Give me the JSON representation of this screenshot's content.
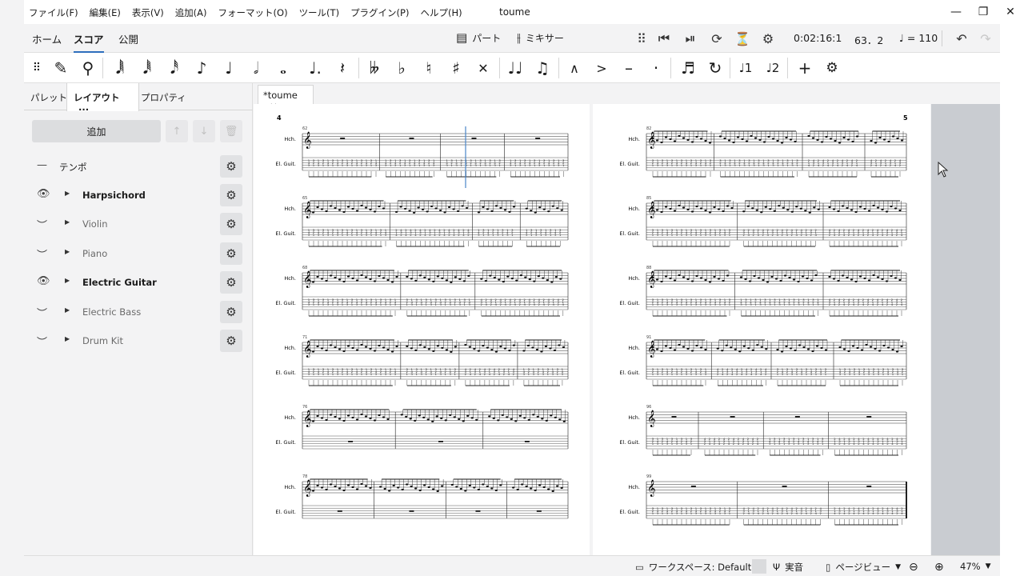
{
  "window": {
    "title": "toume",
    "menu": [
      "ファイル(F)",
      "編集(E)",
      "表示(V)",
      "追加(A)",
      "フォーマット(O)",
      "ツール(T)",
      "プラグイン(P)",
      "ヘルプ(H)"
    ]
  },
  "nav": {
    "tabs": [
      "ホーム",
      "スコア",
      "公開"
    ],
    "parts_label": "パート",
    "mixer_label": "ミキサー",
    "playback_time": "0:02:16:1",
    "measure_beat": "63．2",
    "tempo_value": "= 110"
  },
  "panel": {
    "tabs": [
      "パレット",
      "レイアウト",
      "プロパティ"
    ],
    "tab_more": "···",
    "add_label": "追加",
    "items": [
      {
        "label": "テンポ",
        "visible": null,
        "style": "normal"
      },
      {
        "label": "Harpsichord",
        "visible": true,
        "style": "bold"
      },
      {
        "label": "Violin",
        "visible": false,
        "style": "dim"
      },
      {
        "label": "Piano",
        "visible": false,
        "style": "dim"
      },
      {
        "label": "Electric Guitar",
        "visible": true,
        "style": "bold"
      },
      {
        "label": "Electric Bass",
        "visible": false,
        "style": "dim"
      },
      {
        "label": "Drum Kit",
        "visible": false,
        "style": "dim"
      }
    ]
  },
  "document": {
    "tab_label": "*toume",
    "page_left_number": "4",
    "page_right_number": "5",
    "staff_hch": "Hch.",
    "staff_gtr": "El. Guit.",
    "left_systems": [
      "62",
      "65",
      "68",
      "71",
      "76",
      "78"
    ],
    "right_systems": [
      "82",
      "85",
      "88",
      "91",
      "96",
      "99"
    ]
  },
  "status": {
    "workspace": "ワークスペース: Default",
    "concert_pitch": "実音",
    "view_mode": "ページビュー",
    "zoom": "47%"
  }
}
